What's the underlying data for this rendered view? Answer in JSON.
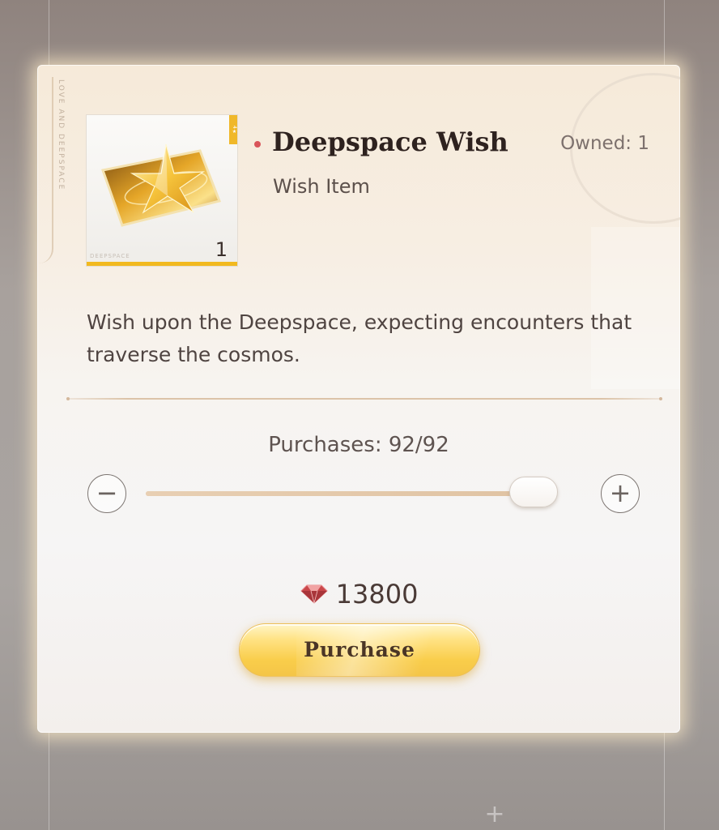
{
  "item": {
    "title": "Deepspace Wish",
    "type": "Wish Item",
    "owned": "Owned: 1",
    "quantity": "1",
    "card_watermark": "DEEPSPACE",
    "card_tag": "4★",
    "brand_vertical": "LOVE AND DEEPSPACE",
    "description": "Wish upon the Deepspace, expecting encounters that traverse the cosmos."
  },
  "purchase": {
    "purchases_text": "Purchases: 92/92",
    "current": 92,
    "max": 92,
    "slider_level": 1.0,
    "decrement_symbol": "−",
    "increment_symbol": "+",
    "price": "13800",
    "currency_icon": "diamond-gem-icon",
    "button_label": "Purchase"
  },
  "colors": {
    "accent_gold": "#f4c548",
    "title_dot": "#d9555a",
    "gem_red": "#c9474a",
    "card_rarity_bar": "#f2b91f"
  }
}
